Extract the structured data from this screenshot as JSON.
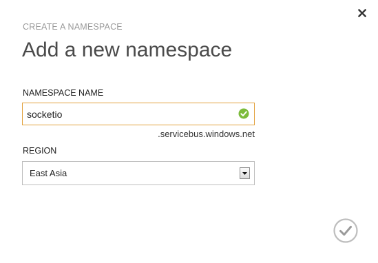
{
  "dialog": {
    "eyebrow": "CREATE A NAMESPACE",
    "title": "Add a new namespace",
    "close_icon": "close-icon",
    "confirm_icon": "checkmark-icon"
  },
  "namespace": {
    "label": "NAMESPACE NAME",
    "value": "socketio",
    "suffix": ".servicebus.windows.net",
    "status_icon": "valid-check-icon"
  },
  "region": {
    "label": "REGION",
    "selected": "East Asia",
    "arrow_icon": "chevron-down-icon"
  },
  "colors": {
    "input_focus_border": "#e2a13c",
    "valid_green": "#7cbb3b",
    "muted_text": "#9a9a9a",
    "title_text": "#4a4a4a"
  }
}
